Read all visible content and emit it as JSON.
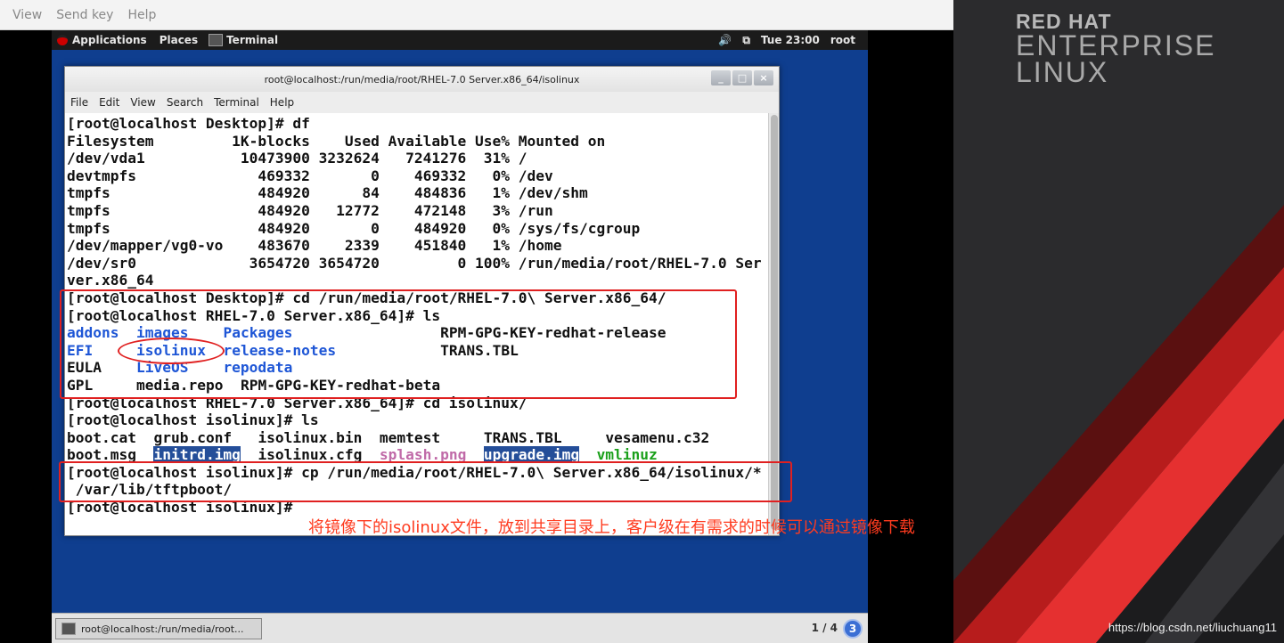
{
  "viewer_menu": [
    "View",
    "Send key",
    "Help"
  ],
  "gnome_bar": {
    "applications": "Applications",
    "places": "Places",
    "terminal": "Terminal",
    "clock": "Tue 23:00",
    "user": "root",
    "volume_glyph": "🔊",
    "display_glyph": "⧉"
  },
  "terminal": {
    "title": "root@localhost:/run/media/root/RHEL-7.0 Server.x86_64/isolinux",
    "controls": [
      "_",
      "□",
      "×"
    ],
    "menu": [
      "File",
      "Edit",
      "View",
      "Search",
      "Terminal",
      "Help"
    ],
    "lines": [
      "[root@localhost Desktop]# df",
      "Filesystem         1K-blocks    Used Available Use% Mounted on",
      "/dev/vda1           10473900 3232624   7241276  31% /",
      "devtmpfs              469332       0    469332   0% /dev",
      "tmpfs                 484920      84    484836   1% /dev/shm",
      "tmpfs                 484920   12772    472148   3% /run",
      "tmpfs                 484920       0    484920   0% /sys/fs/cgroup",
      "/dev/mapper/vg0-vo    483670    2339    451840   1% /home",
      "/dev/sr0             3654720 3654720         0 100% /run/media/root/RHEL-7.0 Ser",
      "ver.x86_64",
      "[root@localhost Desktop]# cd /run/media/root/RHEL-7.0\\ Server.x86_64/",
      "[root@localhost RHEL-7.0 Server.x86_64]# ls"
    ],
    "ls1": [
      [
        "addons",
        "images",
        "Packages",
        "RPM-GPG-KEY-redhat-release"
      ],
      [
        "EFI",
        "isolinux",
        "release-notes",
        "TRANS.TBL"
      ],
      [
        "EULA",
        "LiveOS",
        "repodata",
        ""
      ],
      [
        "GPL",
        "media.repo",
        "RPM-GPG-KEY-redhat-beta",
        ""
      ]
    ],
    "cmd_cd": "[root@localhost RHEL-7.0 Server.x86_64]# cd isolinux/",
    "cmd_ls": "[root@localhost isolinux]# ls",
    "ls2": [
      [
        "boot.cat",
        "grub.conf",
        "isolinux.bin",
        "memtest",
        "TRANS.TBL",
        "vesamenu.c32"
      ],
      [
        "boot.msg",
        "initrd.img",
        "isolinux.cfg",
        "splash.png",
        "upgrade.img",
        "vmlinuz"
      ]
    ],
    "cmd_cp1": "[root@localhost isolinux]# cp /run/media/root/RHEL-7.0\\ Server.x86_64/isolinux/*",
    "cmd_cp2": " /var/lib/tftpboot/",
    "prompt": "[root@localhost isolinux]# "
  },
  "annotation": "将镜像下的isolinux文件，放到共享目录上，客户级在有需求的时候可以通过镜像下载",
  "taskbar": {
    "task": "root@localhost:/run/media/root...",
    "pager": "1 / 4",
    "workspace": "3"
  },
  "brand": {
    "line1": "RED HAT",
    "line2": "ENTERPRISE",
    "line3": "LINUX",
    "url": "https://blog.csdn.net/liuchuang11"
  },
  "colors": {
    "desktop_blue": "#0f3e8f",
    "dir_blue": "#1e56d6",
    "exec_green": "#1ba01b",
    "image_magenta": "#c06aa8",
    "annotation_red": "#e02020",
    "redhat_red": "#cc0000"
  }
}
